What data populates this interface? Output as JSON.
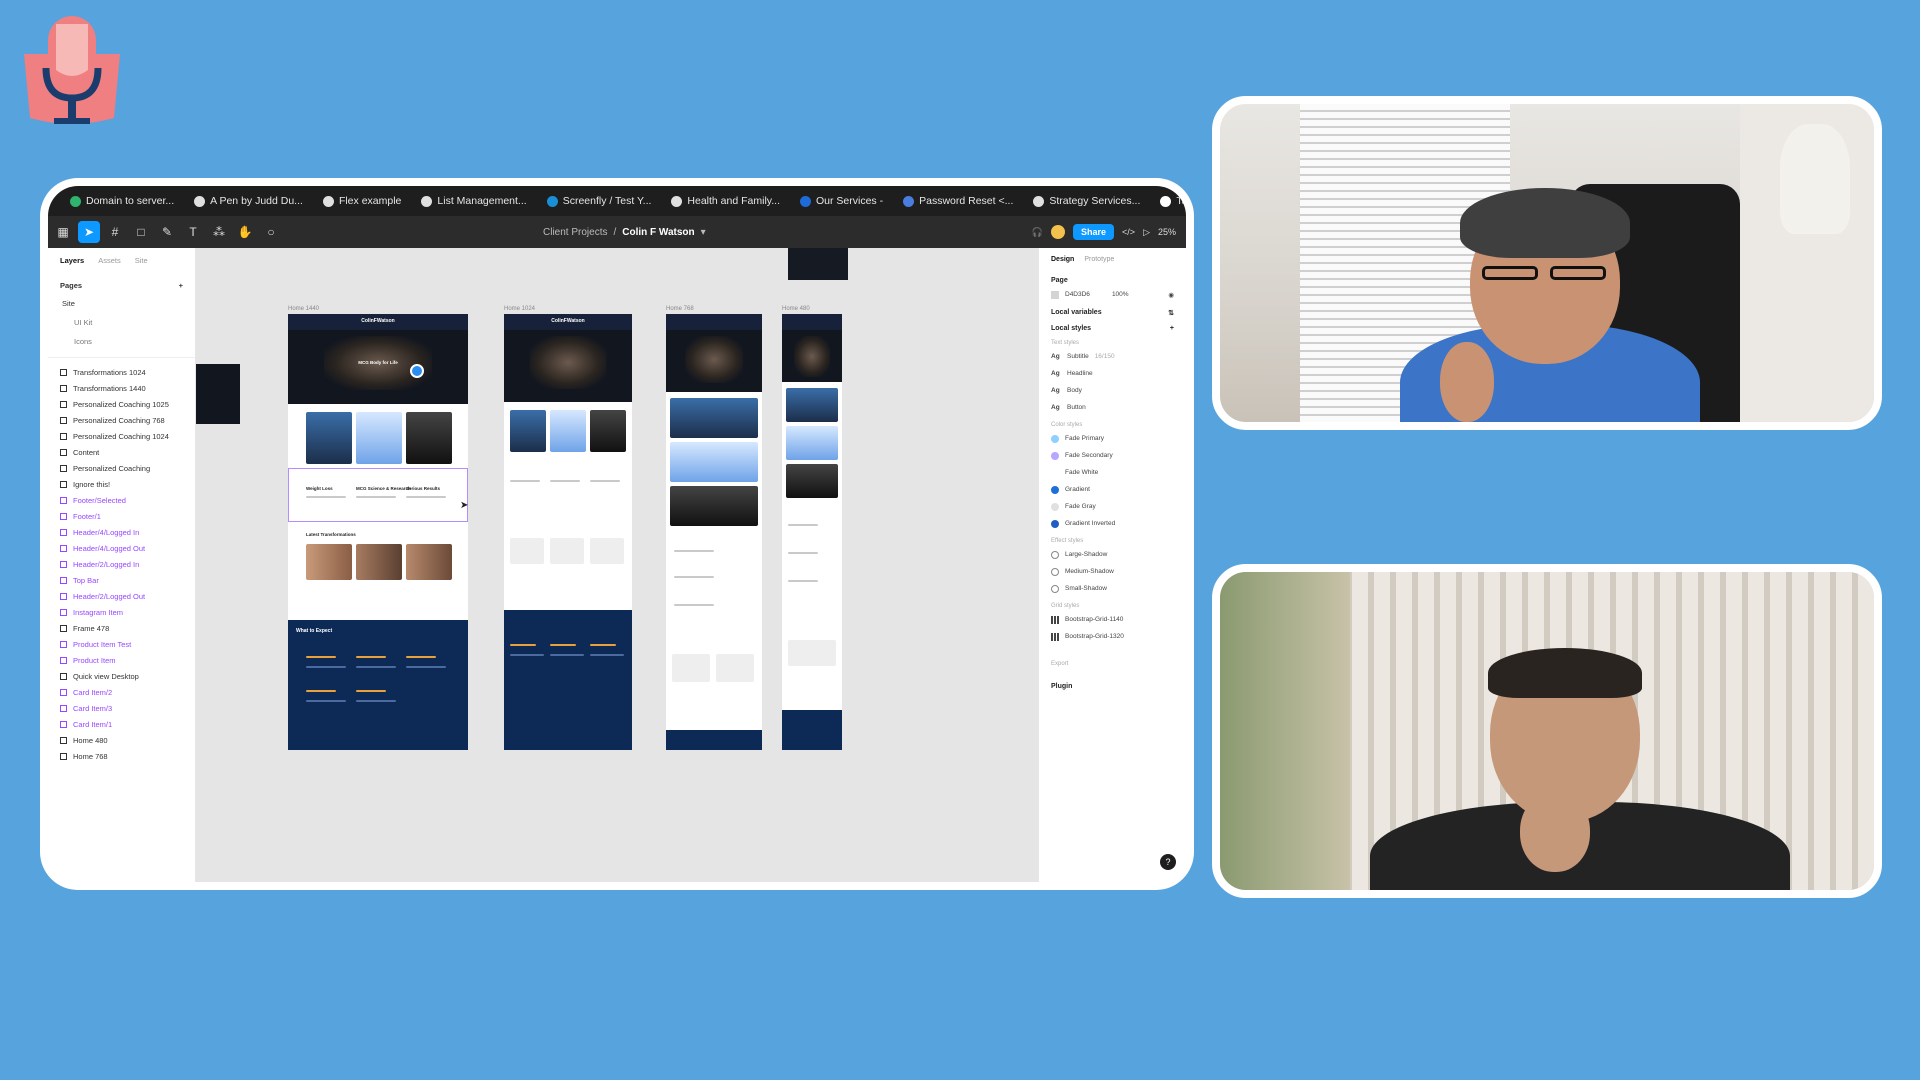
{
  "browser_tabs": [
    {
      "label": "Domain to server...",
      "color": "#2fb36d"
    },
    {
      "label": "A Pen by Judd Du...",
      "color": "#e0e0e0"
    },
    {
      "label": "Flex example",
      "color": "#e0e0e0"
    },
    {
      "label": "List Management...",
      "color": "#e0e0e0"
    },
    {
      "label": "Screenfly / Test Y...",
      "color": "#1a8fd8"
    },
    {
      "label": "Health and Family...",
      "color": "#e0e0e0"
    },
    {
      "label": "Our Services -",
      "color": "#1e6bd8"
    },
    {
      "label": "Password Reset <...",
      "color": "#4a7de0"
    },
    {
      "label": "Strategy Services...",
      "color": "#e0e0e0"
    },
    {
      "label": "Talking About Fas...",
      "color": "#ffffff"
    }
  ],
  "toolbar": {
    "project": "Client Projects",
    "separator": "/",
    "file": "Colin F Watson",
    "share_label": "Share",
    "zoom": "25%",
    "code_icon": "</>",
    "play_icon": "▷"
  },
  "left_panel": {
    "tabs": [
      "Layers",
      "Assets",
      "Site"
    ],
    "pages_title": "Pages",
    "pages": [
      "Site",
      "UI Kit",
      "Icons"
    ],
    "layers": [
      {
        "label": "Transformations 1024",
        "purple": false
      },
      {
        "label": "Transformations 1440",
        "purple": false
      },
      {
        "label": "Personalized Coaching 1025",
        "purple": false
      },
      {
        "label": "Personalized Coaching 768",
        "purple": false
      },
      {
        "label": "Personalized Coaching 1024",
        "purple": false
      },
      {
        "label": "Content",
        "purple": false
      },
      {
        "label": "Personalized Coaching",
        "purple": false
      },
      {
        "label": "Ignore this!",
        "purple": false
      },
      {
        "label": "Footer/Selected",
        "purple": true
      },
      {
        "label": "Footer/1",
        "purple": true
      },
      {
        "label": "Header/4/Logged In",
        "purple": true
      },
      {
        "label": "Header/4/Logged Out",
        "purple": true
      },
      {
        "label": "Header/2/Logged In",
        "purple": true
      },
      {
        "label": "Top Bar",
        "purple": true
      },
      {
        "label": "Header/2/Logged Out",
        "purple": true
      },
      {
        "label": "Instagram Item",
        "purple": true
      },
      {
        "label": "Frame 478",
        "purple": false
      },
      {
        "label": "Product Item Test",
        "purple": true
      },
      {
        "label": "Product Item",
        "purple": true
      },
      {
        "label": "Quick view Desktop",
        "purple": false
      },
      {
        "label": "Card Item/2",
        "purple": true
      },
      {
        "label": "Card Item/3",
        "purple": true
      },
      {
        "label": "Card Item/1",
        "purple": true
      },
      {
        "label": "Home 480",
        "purple": false
      },
      {
        "label": "Home 768",
        "purple": false
      }
    ]
  },
  "canvas": {
    "frames": [
      {
        "label": "Home 1440"
      },
      {
        "label": "Home 1024"
      },
      {
        "label": "Home 768"
      },
      {
        "label": "Home 480"
      }
    ],
    "brand": "ColinFWatson",
    "hero_headline": "MCG Body for Life",
    "section_transformations": "Latest Transformations",
    "section_expect": "What to Expect",
    "card_titles": [
      "Weight Loss",
      "MCG Science & Research",
      "Serious Results"
    ]
  },
  "right_panel": {
    "tabs": [
      "Design",
      "Prototype"
    ],
    "page_title": "Page",
    "page_fill": "D4D3D6",
    "page_opacity": "100%",
    "local_variables": "Local variables",
    "local_styles": "Local styles",
    "text_styles_title": "Text styles",
    "text_styles": [
      {
        "label": "Subtitle",
        "meta": "16/150"
      },
      {
        "label": "Headline",
        "meta": ""
      },
      {
        "label": "Body",
        "meta": ""
      },
      {
        "label": "Button",
        "meta": ""
      }
    ],
    "color_styles_title": "Color styles",
    "color_styles": [
      {
        "label": "Fade Primary",
        "color": "#8fd0ff"
      },
      {
        "label": "Fade Secondary",
        "color": "#b8a6ff"
      },
      {
        "label": "Fade White",
        "color": "#ffffff"
      },
      {
        "label": "Gradient",
        "color": "#1e6fd9"
      },
      {
        "label": "Fade Gray",
        "color": "#e0e0e0"
      },
      {
        "label": "Gradient Inverted",
        "color": "#1f5fc4"
      }
    ],
    "effect_styles_title": "Effect styles",
    "effect_styles": [
      "Large-Shadow",
      "Medium-Shadow",
      "Small-Shadow"
    ],
    "grid_styles_title": "Grid styles",
    "grid_styles": [
      "Bootstrap-Grid-1140",
      "Bootstrap-Grid-1320"
    ],
    "export_label": "Export",
    "plugin_label": "Plugin",
    "help_label": "?"
  }
}
